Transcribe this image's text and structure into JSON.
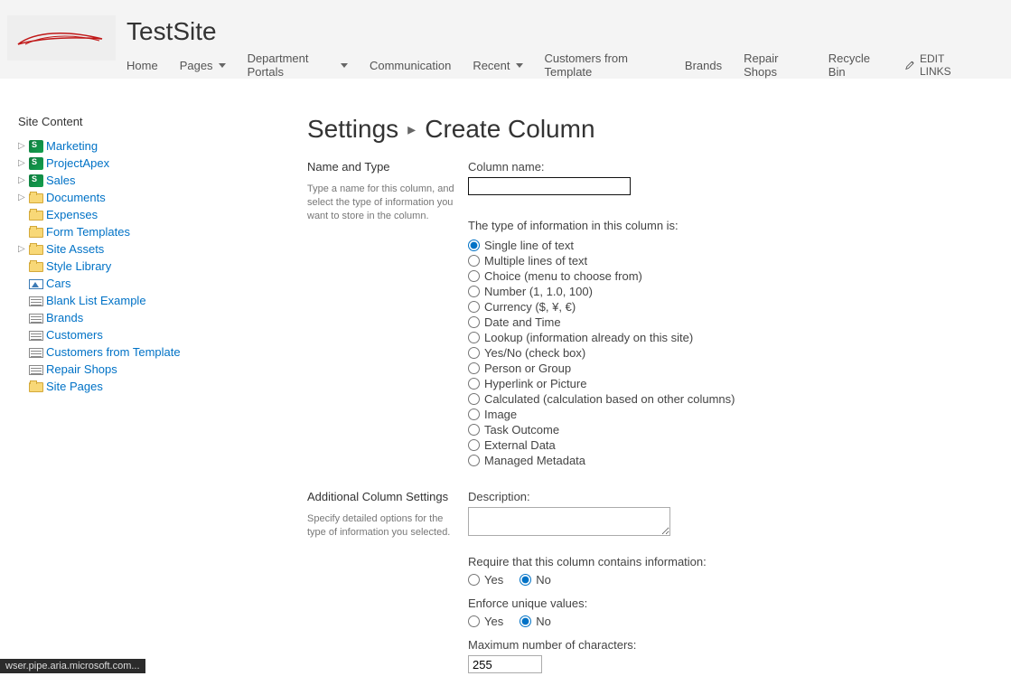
{
  "header": {
    "site_title": "TestSite",
    "nav": [
      "Home",
      "Pages",
      "Department Portals",
      "Communication",
      "Recent",
      "Customers from Template",
      "Brands",
      "Repair Shops",
      "Recycle Bin"
    ],
    "nav_dropdown_indices": [
      1,
      2,
      4
    ],
    "edit_links": "EDIT LINKS"
  },
  "tree": {
    "title": "Site Content",
    "items": [
      {
        "label": "Marketing",
        "icon": "sp",
        "expand": true,
        "indent": 0
      },
      {
        "label": "ProjectApex",
        "icon": "sp",
        "expand": true,
        "indent": 0
      },
      {
        "label": "Sales",
        "icon": "sp",
        "expand": true,
        "indent": 0
      },
      {
        "label": "Documents",
        "icon": "folder",
        "expand": true,
        "indent": 1
      },
      {
        "label": "Expenses",
        "icon": "folder",
        "expand": false,
        "indent": 1
      },
      {
        "label": "Form Templates",
        "icon": "folder",
        "expand": false,
        "indent": 1
      },
      {
        "label": "Site Assets",
        "icon": "folder",
        "expand": true,
        "indent": 1
      },
      {
        "label": "Style Library",
        "icon": "folder",
        "expand": false,
        "indent": 1
      },
      {
        "label": "Cars",
        "icon": "pic",
        "expand": false,
        "indent": 1
      },
      {
        "label": "Blank List Example",
        "icon": "list",
        "expand": false,
        "indent": 1
      },
      {
        "label": "Brands",
        "icon": "list",
        "expand": false,
        "indent": 1
      },
      {
        "label": "Customers",
        "icon": "list",
        "expand": false,
        "indent": 1
      },
      {
        "label": "Customers from Template",
        "icon": "list",
        "expand": false,
        "indent": 1
      },
      {
        "label": "Repair Shops",
        "icon": "list",
        "expand": false,
        "indent": 1
      },
      {
        "label": "Site Pages",
        "icon": "folder",
        "expand": false,
        "indent": 1
      }
    ]
  },
  "breadcrumb": {
    "root": "Settings",
    "leaf": "Create Column"
  },
  "section1": {
    "title": "Name and Type",
    "desc": "Type a name for this column, and select the type of information you want to store in the column.",
    "col_name_label": "Column name:",
    "col_name_value": "",
    "type_label": "The type of information in this column is:",
    "types": [
      "Single line of text",
      "Multiple lines of text",
      "Choice (menu to choose from)",
      "Number (1, 1.0, 100)",
      "Currency ($, ¥, €)",
      "Date and Time",
      "Lookup (information already on this site)",
      "Yes/No (check box)",
      "Person or Group",
      "Hyperlink or Picture",
      "Calculated (calculation based on other columns)",
      "Image",
      "Task Outcome",
      "External Data",
      "Managed Metadata"
    ],
    "selected_type_index": 0
  },
  "section2": {
    "title": "Additional Column Settings",
    "desc": "Specify detailed options for the type of information you selected.",
    "desc_label": "Description:",
    "desc_value": "",
    "require_label": "Require that this column contains information:",
    "yes": "Yes",
    "no": "No",
    "require_value": "No",
    "unique_label": "Enforce unique values:",
    "unique_value": "No",
    "max_label": "Maximum number of characters:",
    "max_value": "255"
  },
  "status_bar": "wser.pipe.aria.microsoft.com..."
}
